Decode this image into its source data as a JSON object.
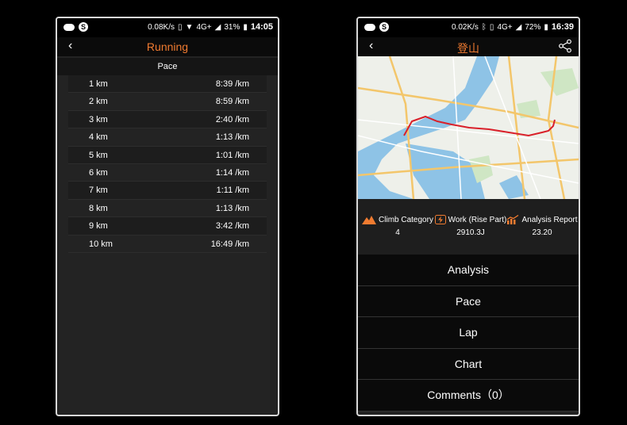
{
  "left": {
    "status": {
      "speed": "0.08K/s",
      "network": "4G+",
      "battery": "31%",
      "time": "14:05"
    },
    "title": "Running",
    "section_header": "Pace",
    "rows": [
      {
        "km": "1 km",
        "pace": "8:39 /km"
      },
      {
        "km": "2 km",
        "pace": "8:59 /km"
      },
      {
        "km": "3 km",
        "pace": "2:40 /km"
      },
      {
        "km": "4 km",
        "pace": "1:13 /km"
      },
      {
        "km": "5 km",
        "pace": "1:01 /km"
      },
      {
        "km": "6 km",
        "pace": "1:14 /km"
      },
      {
        "km": "7 km",
        "pace": "1:11 /km"
      },
      {
        "km": "8 km",
        "pace": "1:13 /km"
      },
      {
        "km": "9 km",
        "pace": "3:42 /km"
      },
      {
        "km": "10 km",
        "pace": "16:49 /km"
      }
    ]
  },
  "right": {
    "status": {
      "speed": "0.02K/s",
      "network": "4G+",
      "battery": "72%",
      "time": "16:39"
    },
    "title": "登山",
    "stats": [
      {
        "label": "Climb Category",
        "value": "4",
        "icon": "mountain-icon"
      },
      {
        "label": "Work (Rise Part)",
        "value": "2910.3J",
        "icon": "lightning-icon"
      },
      {
        "label": "Analysis Report",
        "value": "23.20",
        "icon": "trend-chart-icon"
      }
    ],
    "menu": [
      "Analysis",
      "Pace",
      "Lap",
      "Chart",
      "Comments（0）"
    ]
  },
  "colors": {
    "accent": "#f07b30",
    "route": "#d9202a",
    "water": "#8ec3e6"
  }
}
